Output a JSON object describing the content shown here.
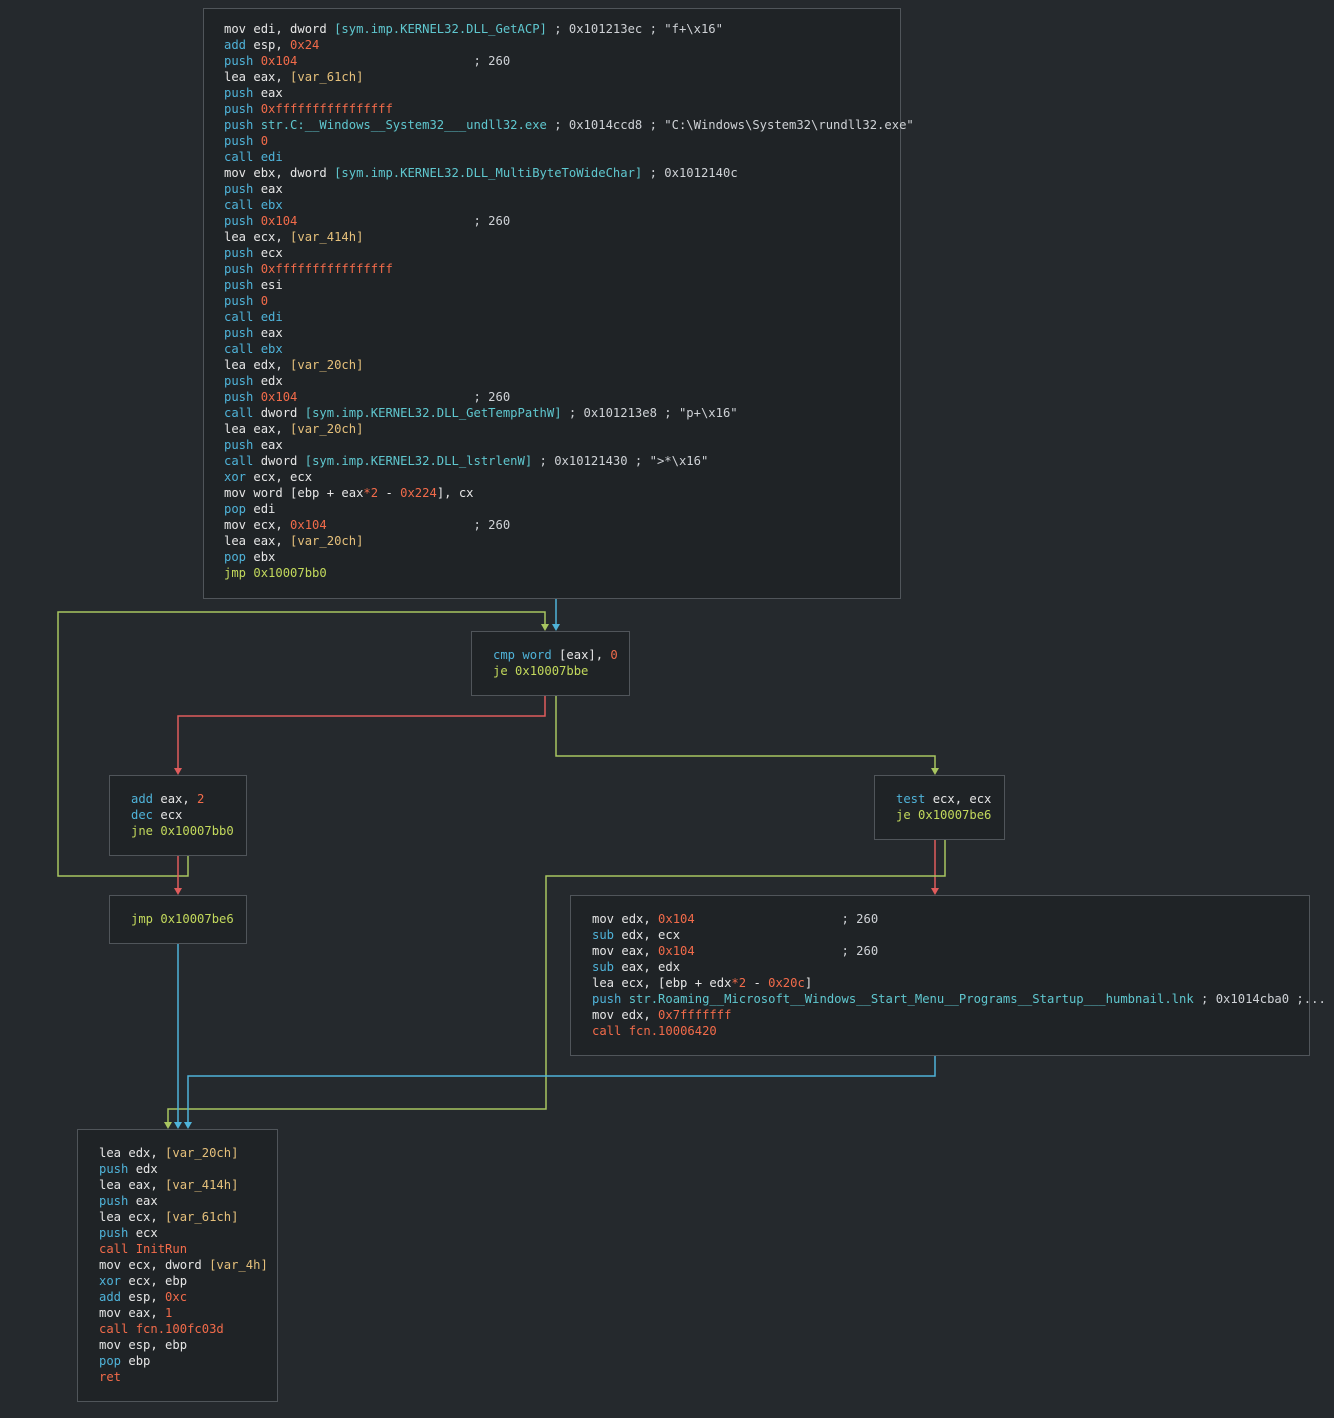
{
  "blocks": [
    {
      "id": "block-top",
      "lines": [
        [
          [
            "mov",
            "mn"
          ],
          [
            " edi, dword ",
            "op"
          ],
          [
            "[sym.imp.KERNEL32.DLL_GetACP]",
            "sym"
          ],
          [
            " ; 0x101213ec ; \"f+\\x16\"",
            "cm"
          ]
        ],
        [
          [
            "add",
            "kw"
          ],
          [
            " esp, ",
            "op"
          ],
          [
            "0x24",
            "num"
          ]
        ],
        [
          [
            "push",
            "kw"
          ],
          [
            " ",
            "op"
          ],
          [
            "0x104",
            "num"
          ],
          [
            "                        ; 260",
            "cm"
          ]
        ],
        [
          [
            "lea",
            "mn"
          ],
          [
            " eax, ",
            "op"
          ],
          [
            "[var_61ch]",
            "var"
          ]
        ],
        [
          [
            "push",
            "kw"
          ],
          [
            " eax",
            "op"
          ]
        ],
        [
          [
            "push",
            "kw"
          ],
          [
            " ",
            "op"
          ],
          [
            "0xffffffffffffffff",
            "num"
          ]
        ],
        [
          [
            "push",
            "kw"
          ],
          [
            " ",
            "op"
          ],
          [
            "str.C:__Windows__System32___undll32.exe",
            "sym"
          ],
          [
            " ; 0x1014ccd8 ; \"C:\\Windows\\System32\\rundll32.exe\"",
            "cm"
          ]
        ],
        [
          [
            "push",
            "kw"
          ],
          [
            " ",
            "op"
          ],
          [
            "0",
            "num"
          ]
        ],
        [
          [
            "call",
            "kw"
          ],
          [
            " ",
            "op"
          ],
          [
            "edi",
            "kw"
          ]
        ],
        [
          [
            "mov",
            "mn"
          ],
          [
            " ebx, dword ",
            "op"
          ],
          [
            "[sym.imp.KERNEL32.DLL_MultiByteToWideChar]",
            "sym"
          ],
          [
            " ; 0x1012140c",
            "cm"
          ]
        ],
        [
          [
            "push",
            "kw"
          ],
          [
            " eax",
            "op"
          ]
        ],
        [
          [
            "call",
            "kw"
          ],
          [
            " ",
            "op"
          ],
          [
            "ebx",
            "kw"
          ]
        ],
        [
          [
            "push",
            "kw"
          ],
          [
            " ",
            "op"
          ],
          [
            "0x104",
            "num"
          ],
          [
            "                        ; 260",
            "cm"
          ]
        ],
        [
          [
            "lea",
            "mn"
          ],
          [
            " ecx, ",
            "op"
          ],
          [
            "[var_414h]",
            "var"
          ]
        ],
        [
          [
            "push",
            "kw"
          ],
          [
            " ecx",
            "op"
          ]
        ],
        [
          [
            "push",
            "kw"
          ],
          [
            " ",
            "op"
          ],
          [
            "0xffffffffffffffff",
            "num"
          ]
        ],
        [
          [
            "push",
            "kw"
          ],
          [
            " esi",
            "op"
          ]
        ],
        [
          [
            "push",
            "kw"
          ],
          [
            " ",
            "op"
          ],
          [
            "0",
            "num"
          ]
        ],
        [
          [
            "call",
            "kw"
          ],
          [
            " ",
            "op"
          ],
          [
            "edi",
            "kw"
          ]
        ],
        [
          [
            "push",
            "kw"
          ],
          [
            " eax",
            "op"
          ]
        ],
        [
          [
            "call",
            "kw"
          ],
          [
            " ",
            "op"
          ],
          [
            "ebx",
            "kw"
          ]
        ],
        [
          [
            "lea",
            "mn"
          ],
          [
            " edx, ",
            "op"
          ],
          [
            "[var_20ch]",
            "var"
          ]
        ],
        [
          [
            "push",
            "kw"
          ],
          [
            " edx",
            "op"
          ]
        ],
        [
          [
            "push",
            "kw"
          ],
          [
            " ",
            "op"
          ],
          [
            "0x104",
            "num"
          ],
          [
            "                        ; 260",
            "cm"
          ]
        ],
        [
          [
            "call",
            "kw"
          ],
          [
            " dword ",
            "op"
          ],
          [
            "[sym.imp.KERNEL32.DLL_GetTempPathW]",
            "sym"
          ],
          [
            " ; 0x101213e8 ; \"p+\\x16\"",
            "cm"
          ]
        ],
        [
          [
            "lea",
            "mn"
          ],
          [
            " eax, ",
            "op"
          ],
          [
            "[var_20ch]",
            "var"
          ]
        ],
        [
          [
            "push",
            "kw"
          ],
          [
            " eax",
            "op"
          ]
        ],
        [
          [
            "call",
            "kw"
          ],
          [
            " dword ",
            "op"
          ],
          [
            "[sym.imp.KERNEL32.DLL_lstrlenW]",
            "sym"
          ],
          [
            " ; 0x10121430 ; \">*\\x16\"",
            "cm"
          ]
        ],
        [
          [
            "xor",
            "kw"
          ],
          [
            " ecx, ecx",
            "op"
          ]
        ],
        [
          [
            "mov",
            "mn"
          ],
          [
            " word [ebp + eax",
            "op"
          ],
          [
            "*2",
            "num"
          ],
          [
            " - ",
            "op"
          ],
          [
            "0x224",
            "num"
          ],
          [
            "], cx",
            "op"
          ]
        ],
        [
          [
            "pop",
            "kw"
          ],
          [
            " edi",
            "op"
          ]
        ],
        [
          [
            "mov",
            "mn"
          ],
          [
            " ecx, ",
            "op"
          ],
          [
            "0x104",
            "num"
          ],
          [
            "                    ; 260",
            "cm"
          ]
        ],
        [
          [
            "lea",
            "mn"
          ],
          [
            " eax, ",
            "op"
          ],
          [
            "[var_20ch]",
            "var"
          ]
        ],
        [
          [
            "pop",
            "kw"
          ],
          [
            " ebx",
            "op"
          ]
        ],
        [
          [
            "jmp",
            "jm"
          ],
          [
            " 0x10007bb0",
            "jm"
          ]
        ]
      ]
    },
    {
      "id": "block-cmp",
      "lines": [
        [
          [
            "cmp",
            "kw"
          ],
          [
            " ",
            "op"
          ],
          [
            "word",
            "kw"
          ],
          [
            " [eax], ",
            "op"
          ],
          [
            "0",
            "num"
          ]
        ],
        [
          [
            "je",
            "jm"
          ],
          [
            " 0x10007bbe",
            "jm"
          ]
        ]
      ]
    },
    {
      "id": "block-add",
      "lines": [
        [
          [
            "add",
            "kw"
          ],
          [
            " eax, ",
            "op"
          ],
          [
            "2",
            "num"
          ]
        ],
        [
          [
            "dec",
            "kw"
          ],
          [
            " ecx",
            "op"
          ]
        ],
        [
          [
            "jne",
            "jm"
          ],
          [
            " 0x10007bb0",
            "jm"
          ]
        ]
      ]
    },
    {
      "id": "block-jmp",
      "lines": [
        [
          [
            "jmp",
            "jm"
          ],
          [
            " 0x10007be6",
            "jm"
          ]
        ]
      ]
    },
    {
      "id": "block-test",
      "lines": [
        [
          [
            "test",
            "kw"
          ],
          [
            " ecx, ecx",
            "op"
          ]
        ],
        [
          [
            "je",
            "jm"
          ],
          [
            " 0x10007be6",
            "jm"
          ]
        ]
      ]
    },
    {
      "id": "block-mov",
      "lines": [
        [
          [
            "mov",
            "mn"
          ],
          [
            " edx, ",
            "op"
          ],
          [
            "0x104",
            "num"
          ],
          [
            "                    ; 260",
            "cm"
          ]
        ],
        [
          [
            "sub",
            "kw"
          ],
          [
            " edx, ecx",
            "op"
          ]
        ],
        [
          [
            "mov",
            "mn"
          ],
          [
            " eax, ",
            "op"
          ],
          [
            "0x104",
            "num"
          ],
          [
            "                    ; 260",
            "cm"
          ]
        ],
        [
          [
            "sub",
            "kw"
          ],
          [
            " eax, edx",
            "op"
          ]
        ],
        [
          [
            "lea",
            "mn"
          ],
          [
            " ecx, [ebp + edx",
            "op"
          ],
          [
            "*2",
            "num"
          ],
          [
            " - ",
            "op"
          ],
          [
            "0x20c",
            "num"
          ],
          [
            "]",
            "op"
          ]
        ],
        [
          [
            "push",
            "kw"
          ],
          [
            " ",
            "op"
          ],
          [
            "str.Roaming__Microsoft__Windows__Start_Menu__Programs__Startup___humbnail.lnk",
            "sym"
          ],
          [
            " ; 0x1014cba0 ;...",
            "cm"
          ]
        ],
        [
          [
            "mov",
            "mn"
          ],
          [
            " edx, ",
            "op"
          ],
          [
            "0x7fffffff",
            "num"
          ]
        ],
        [
          [
            "call",
            "cl"
          ],
          [
            " ",
            "op"
          ],
          [
            "fcn.10006420",
            "cl"
          ]
        ]
      ]
    },
    {
      "id": "block-final",
      "lines": [
        [
          [
            "lea",
            "mn"
          ],
          [
            " edx, ",
            "op"
          ],
          [
            "[var_20ch]",
            "var"
          ]
        ],
        [
          [
            "push",
            "kw"
          ],
          [
            " edx",
            "op"
          ]
        ],
        [
          [
            "lea",
            "mn"
          ],
          [
            " eax, ",
            "op"
          ],
          [
            "[var_414h]",
            "var"
          ]
        ],
        [
          [
            "push",
            "kw"
          ],
          [
            " eax",
            "op"
          ]
        ],
        [
          [
            "lea",
            "mn"
          ],
          [
            " ecx, ",
            "op"
          ],
          [
            "[var_61ch]",
            "var"
          ]
        ],
        [
          [
            "push",
            "kw"
          ],
          [
            " ecx",
            "op"
          ]
        ],
        [
          [
            "call",
            "cl"
          ],
          [
            " ",
            "op"
          ],
          [
            "InitRun",
            "cl"
          ]
        ],
        [
          [
            "mov",
            "mn"
          ],
          [
            " ecx, dword ",
            "op"
          ],
          [
            "[var_4h]",
            "var"
          ]
        ],
        [
          [
            "xor",
            "kw"
          ],
          [
            " ecx, ebp",
            "op"
          ]
        ],
        [
          [
            "add",
            "kw"
          ],
          [
            " esp, ",
            "op"
          ],
          [
            "0xc",
            "num"
          ]
        ],
        [
          [
            "mov",
            "mn"
          ],
          [
            " eax, ",
            "op"
          ],
          [
            "1",
            "num"
          ]
        ],
        [
          [
            "call",
            "cl"
          ],
          [
            " ",
            "op"
          ],
          [
            "fcn.100fc03d",
            "cl"
          ]
        ],
        [
          [
            "mov",
            "mn"
          ],
          [
            " esp, ebp",
            "op"
          ]
        ],
        [
          [
            "pop",
            "kw"
          ],
          [
            " ebp",
            "op"
          ]
        ],
        [
          [
            "ret",
            "cl"
          ]
        ]
      ]
    }
  ],
  "edge_colors": {
    "unconditional": "#4fb3d9",
    "true_branch": "#a8c560",
    "false_branch": "#e05c5c"
  }
}
